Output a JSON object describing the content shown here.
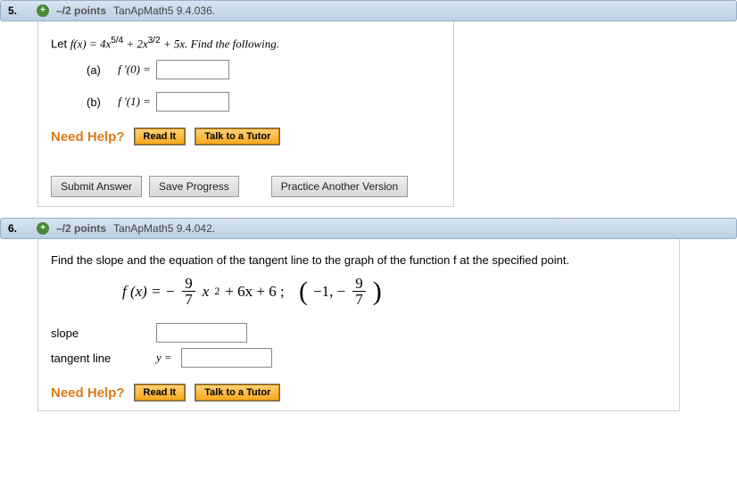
{
  "q5": {
    "number": "5.",
    "points": "–/2 points",
    "source": "TanApMath5 9.4.036.",
    "prompt_prefix": "Let ",
    "prompt_func": "f(x) = 4x",
    "prompt_exp1": "5/4",
    "prompt_plus1": " + 2x",
    "prompt_exp2": "3/2",
    "prompt_suffix": " + 5x. Find the following.",
    "part_a_label": "(a)",
    "part_a_expr": "f '(0) =",
    "part_b_label": "(b)",
    "part_b_expr": "f '(1) =",
    "need_help": "Need Help?",
    "read_it": "Read It",
    "talk_tutor": "Talk to a Tutor",
    "submit": "Submit Answer",
    "save": "Save Progress",
    "practice": "Practice Another Version"
  },
  "q6": {
    "number": "6.",
    "points": "–/2 points",
    "source": "TanApMath5 9.4.042.",
    "prompt": "Find the slope and the equation of the tangent line to the graph of the function f at the specified point.",
    "math": {
      "lhs": "f (x) = −",
      "frac1_num": "9",
      "frac1_den": "7",
      "mid": "x",
      "exp": "2",
      "rest": " + 6x + 6 ;",
      "pt_open": "(",
      "pt_x": "−1, −",
      "frac2_num": "9",
      "frac2_den": "7",
      "pt_close": ")"
    },
    "slope_label": "slope",
    "tangent_label": "tangent line",
    "y_eq": "y =",
    "need_help": "Need Help?",
    "read_it": "Read It",
    "talk_tutor": "Talk to a Tutor"
  }
}
